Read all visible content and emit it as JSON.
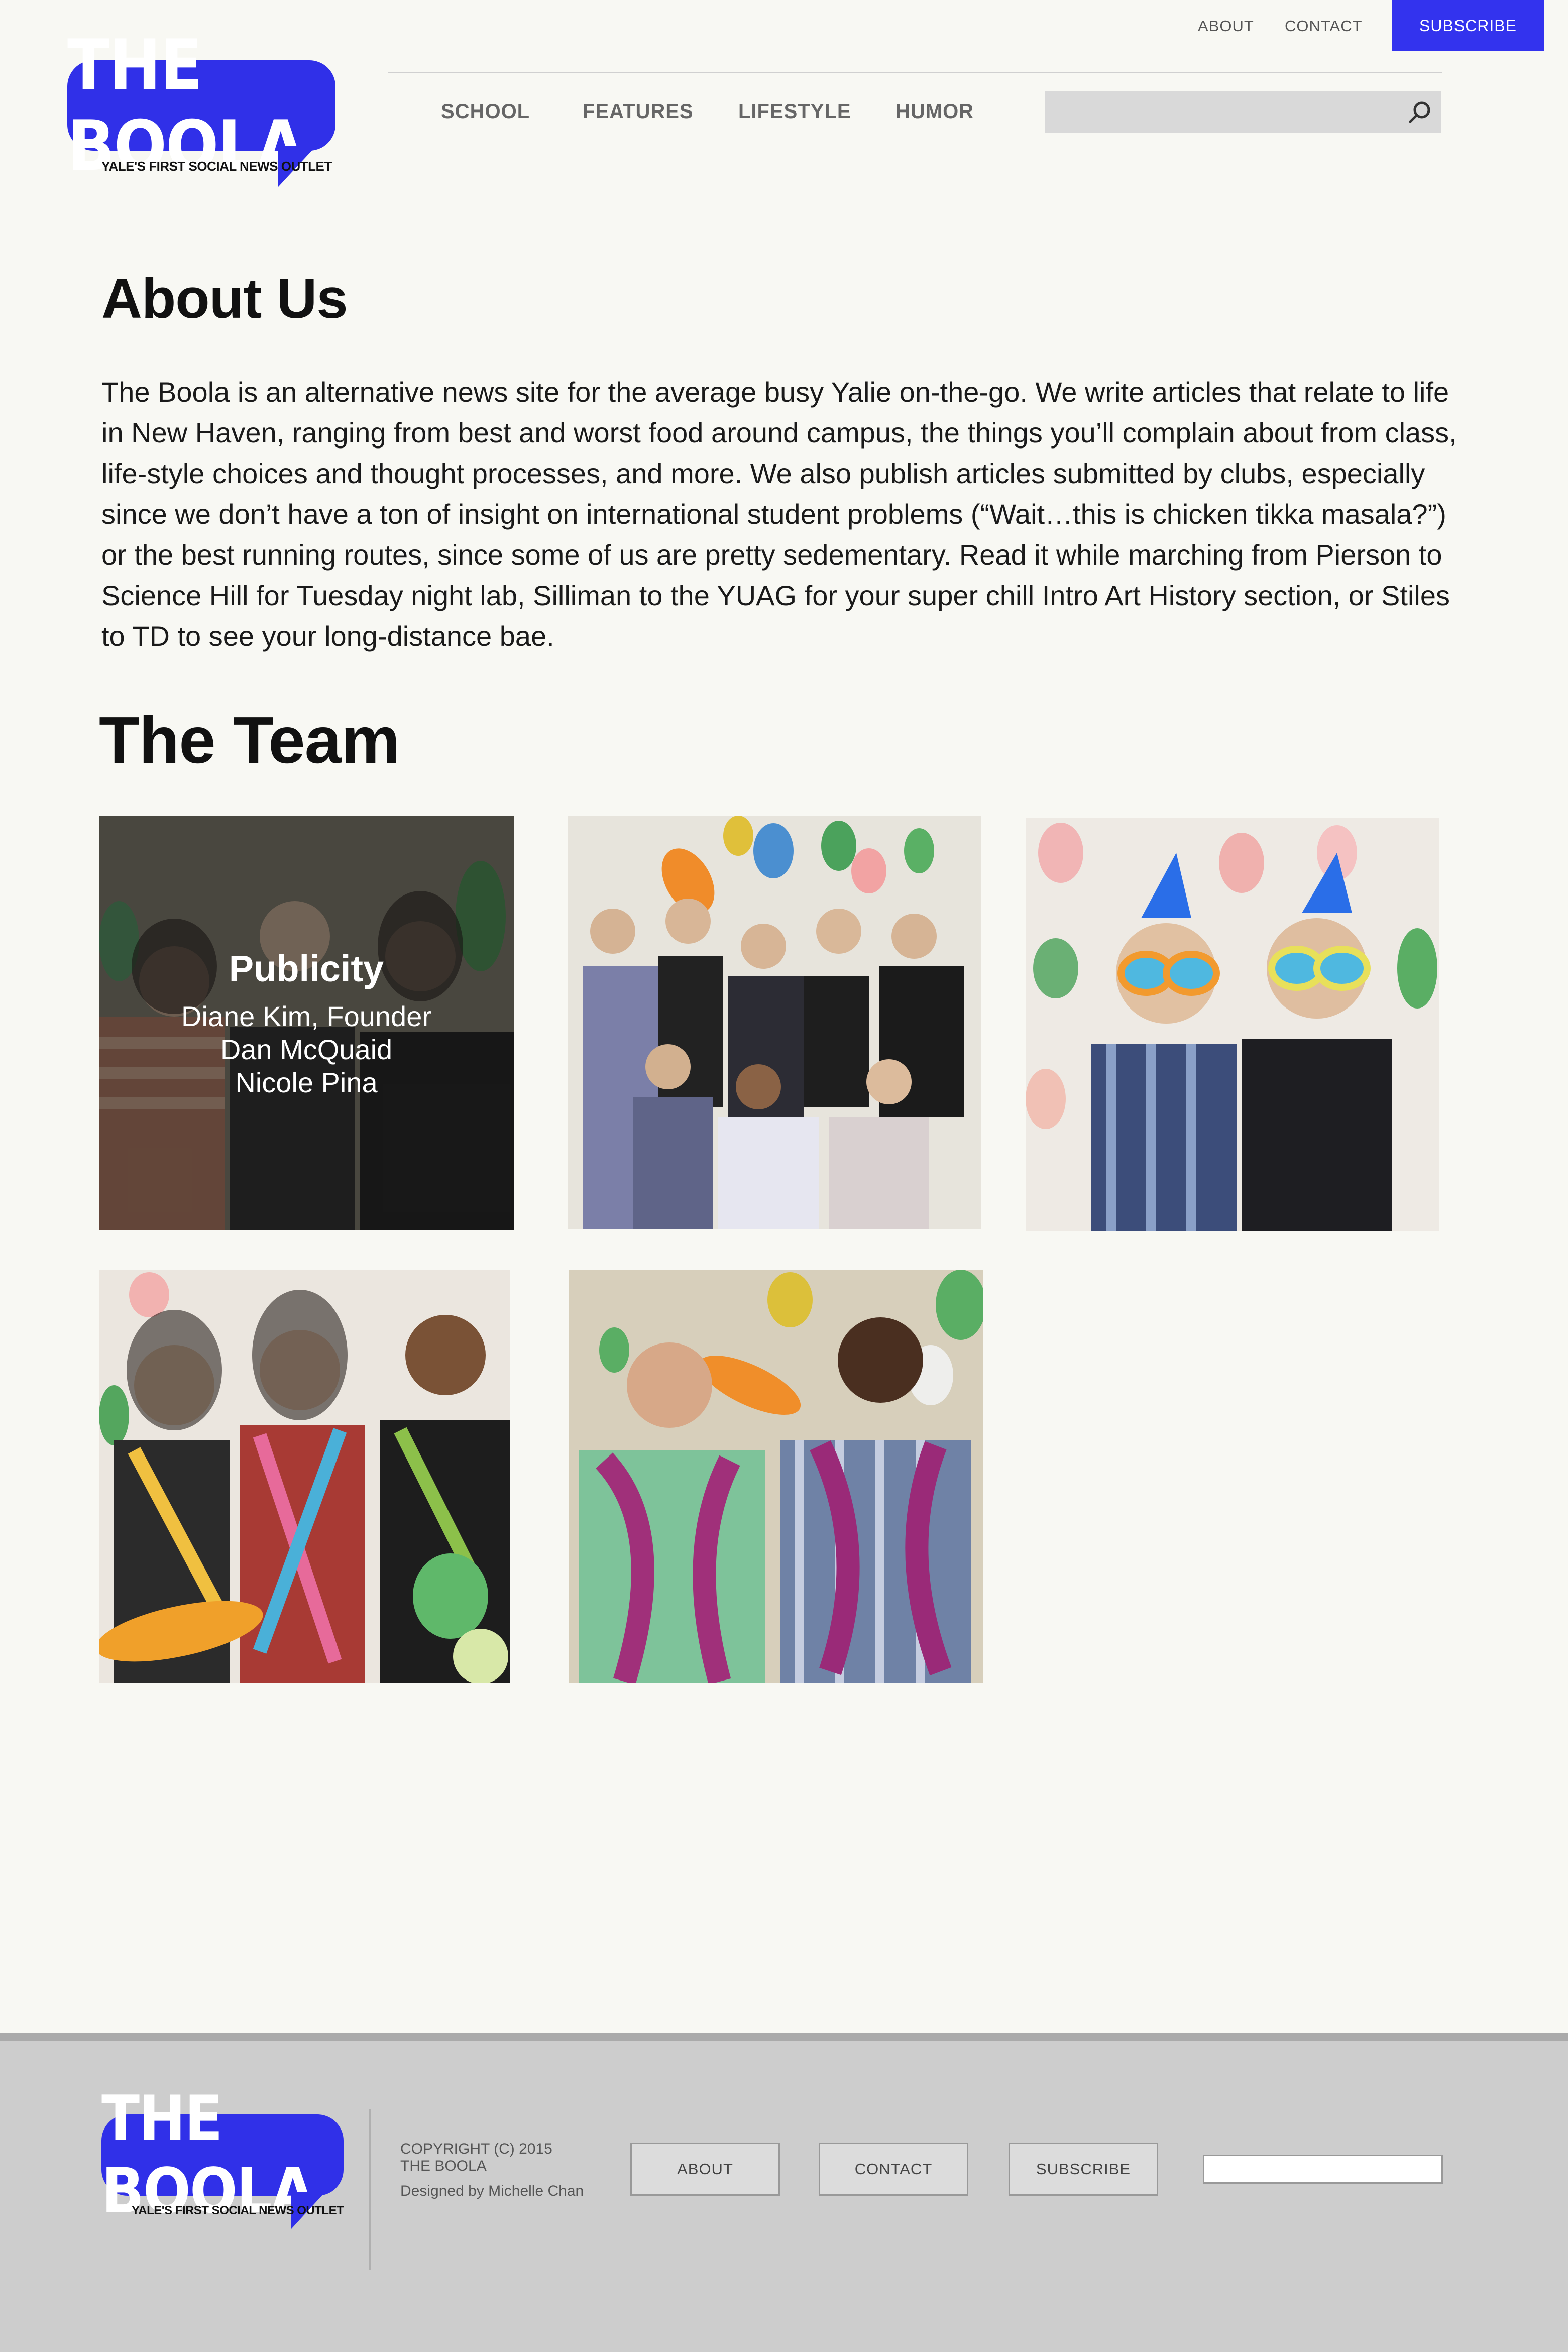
{
  "header": {
    "util_links": [
      "ABOUT",
      "CONTACT"
    ],
    "subscribe_label": "SUBSCRIBE",
    "nav": [
      "SCHOOL",
      "FEATURES",
      "LIFESTYLE",
      "HUMOR"
    ],
    "search_placeholder": ""
  },
  "logo": {
    "name": "THE BOOLA",
    "tagline": "YALE'S FIRST SOCIAL NEWS OUTLET"
  },
  "about": {
    "title": "About Us",
    "body": "The Boola is an alternative news site for the average busy Yalie on-the-go. We write articles that relate to life in New Haven, ranging from best and worst food around campus, the things you’ll complain about from class, life-style choices and thought processes, and more. We also publish articles submitted by clubs, especially since we don’t have a ton of insight on international student problems (“Wait…this is chicken tikka masala?”) or the best running routes, since some of us are pretty sedementary. Read it while marching from Pierson to Science Hill for Tuesday night lab, Silliman to the YUAG for your super chill Intro Art History section, or Stiles to TD to see your long-distance bae."
  },
  "team": {
    "title": "The Team",
    "overlay": {
      "group": "Publicity",
      "members": [
        "Diane Kim, Founder",
        "Dan McQuaid",
        "Nicole Pina"
      ]
    }
  },
  "footer": {
    "copyright": "COPYRIGHT (C) 2015",
    "site": "THE BOOLA",
    "designer": "Designed by Michelle Chan",
    "buttons": [
      "ABOUT",
      "CONTACT",
      "SUBSCRIBE"
    ]
  },
  "colors": {
    "brand_blue": "#3030e8",
    "background": "#f8f8f3",
    "footer_bg": "#cdcdcd"
  }
}
